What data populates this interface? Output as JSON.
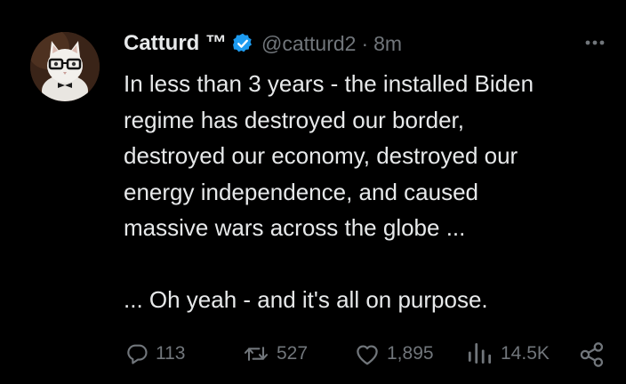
{
  "tweet": {
    "author_name": "Catturd ™",
    "handle": "@catturd2",
    "separator": "·",
    "time": "8m",
    "text_lines": [
      "In less than 3 years - the installed Biden",
      "regime has destroyed our border,",
      "destroyed our economy, destroyed our",
      "energy independence, and caused",
      "massive wars across the globe ..."
    ],
    "text_last": "... Oh yeah - and it's all on purpose.",
    "verified": true
  },
  "actions": {
    "replies": "113",
    "reposts": "527",
    "likes": "1,895",
    "views": "14.5K"
  },
  "icons": {
    "reply": "reply-icon",
    "repost": "repost-icon",
    "like": "heart-icon",
    "views": "views-icon",
    "share": "share-icon",
    "more": "more-icon",
    "verified": "verified-badge-icon"
  },
  "colors": {
    "background": "#000000",
    "text": "#e7e9ea",
    "secondary": "#71767b",
    "verified": "#1d9bf0"
  }
}
